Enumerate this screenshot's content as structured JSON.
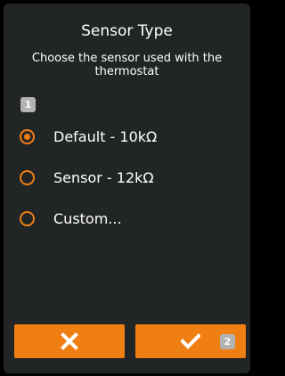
{
  "dialog": {
    "title": "Sensor Type",
    "subtitle": "Choose the sensor used with the thermostat"
  },
  "steps": {
    "options_step": "1",
    "confirm_step": "2"
  },
  "options": [
    {
      "label": "Default - 10kΩ",
      "selected": true
    },
    {
      "label": "Sensor - 12kΩ",
      "selected": false
    },
    {
      "label": "Custom...",
      "selected": false
    }
  ],
  "buttons": {
    "cancel_icon": "close-icon",
    "confirm_icon": "check-icon"
  },
  "colors": {
    "accent": "#f07f13",
    "panel": "#222525",
    "badge": "#b3b3b3"
  }
}
